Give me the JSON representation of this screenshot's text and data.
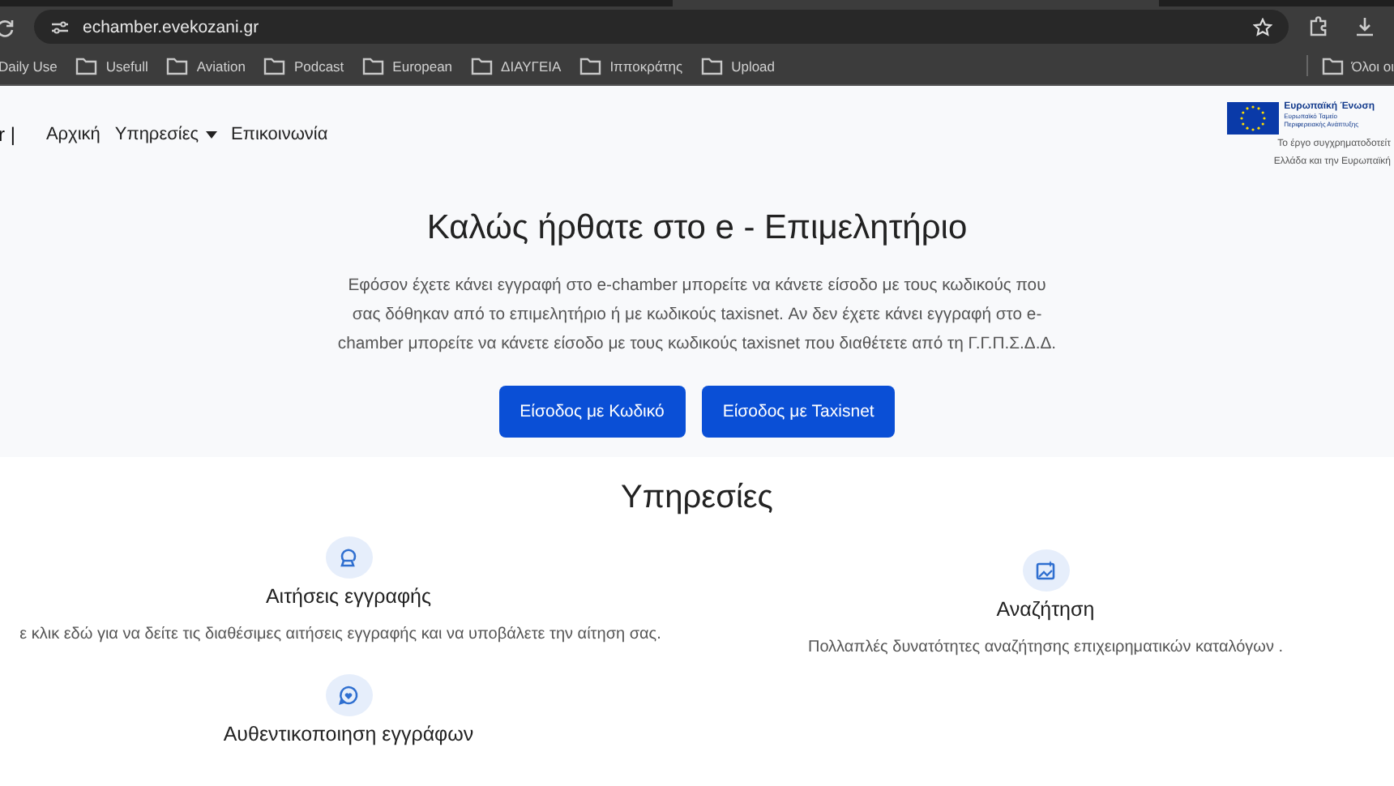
{
  "browser": {
    "url": "echamber.evekozani.gr",
    "bookmarks": [
      {
        "label": "Daily Use",
        "folder": false
      },
      {
        "label": "Usefull",
        "folder": true
      },
      {
        "label": "Aviation",
        "folder": true
      },
      {
        "label": "Podcast",
        "folder": true
      },
      {
        "label": "European",
        "folder": true
      },
      {
        "label": "ΔΙΑΥΓΕΙΑ",
        "folder": true
      },
      {
        "label": "Ιπποκράτης",
        "folder": true
      },
      {
        "label": "Upload",
        "folder": true
      }
    ],
    "other_bookmarks": "Όλοι οι"
  },
  "navbar": {
    "brand": "r |",
    "items": [
      {
        "label": "Αρχική",
        "dropdown": false
      },
      {
        "label": "Υπηρεσίες",
        "dropdown": true
      },
      {
        "label": "Επικοινωνία",
        "dropdown": false
      }
    ],
    "eu_badge": {
      "title": "Ευρωπαϊκή Ένωση",
      "subtitle": "Ευρωπαϊκό Ταμείο Περιφερειακής Ανάπτυξης",
      "caption": [
        "Το έργο συγχρηματοδοτείτ",
        "Ελλάδα και την Ευρωπαϊκή"
      ]
    }
  },
  "hero": {
    "title": "Καλώς ήρθατε στο e - Επιμελητήριο",
    "text": "Εφόσον έχετε κάνει εγγραφή στο e-chamber μπορείτε να κάνετε είσοδο με τους κωδικούς που σας δόθηκαν από το επιμελητήριο ή με κωδικούς taxisnet. Αν δεν έχετε κάνει εγγραφή στο e-chamber μπορείτε να κάνετε είσοδο με τους κωδικούς taxisnet που διαθέτετε από τη Γ.Γ.Π.Σ.Δ.Δ.",
    "buttons": [
      "Είσοδος με Κωδικό",
      "Είσοδος με Taxisnet"
    ]
  },
  "services": {
    "title": "Υπηρεσίες",
    "items": [
      {
        "kind": "applications",
        "title": "Αιτήσεις εγγραφής",
        "text": "ε κλικ εδώ για να δείτε τις διαθέσιμες αιτήσεις εγγραφής και να υποβάλετε την αίτηση σας."
      },
      {
        "kind": "search",
        "title": "Αναζήτηση",
        "text": "Πολλαπλές δυνατότητες αναζήτησης επιχειρηματικών καταλόγων ."
      },
      {
        "kind": "authentication",
        "title": "Αυθεντικοποιηση εγγράφων"
      }
    ]
  }
}
